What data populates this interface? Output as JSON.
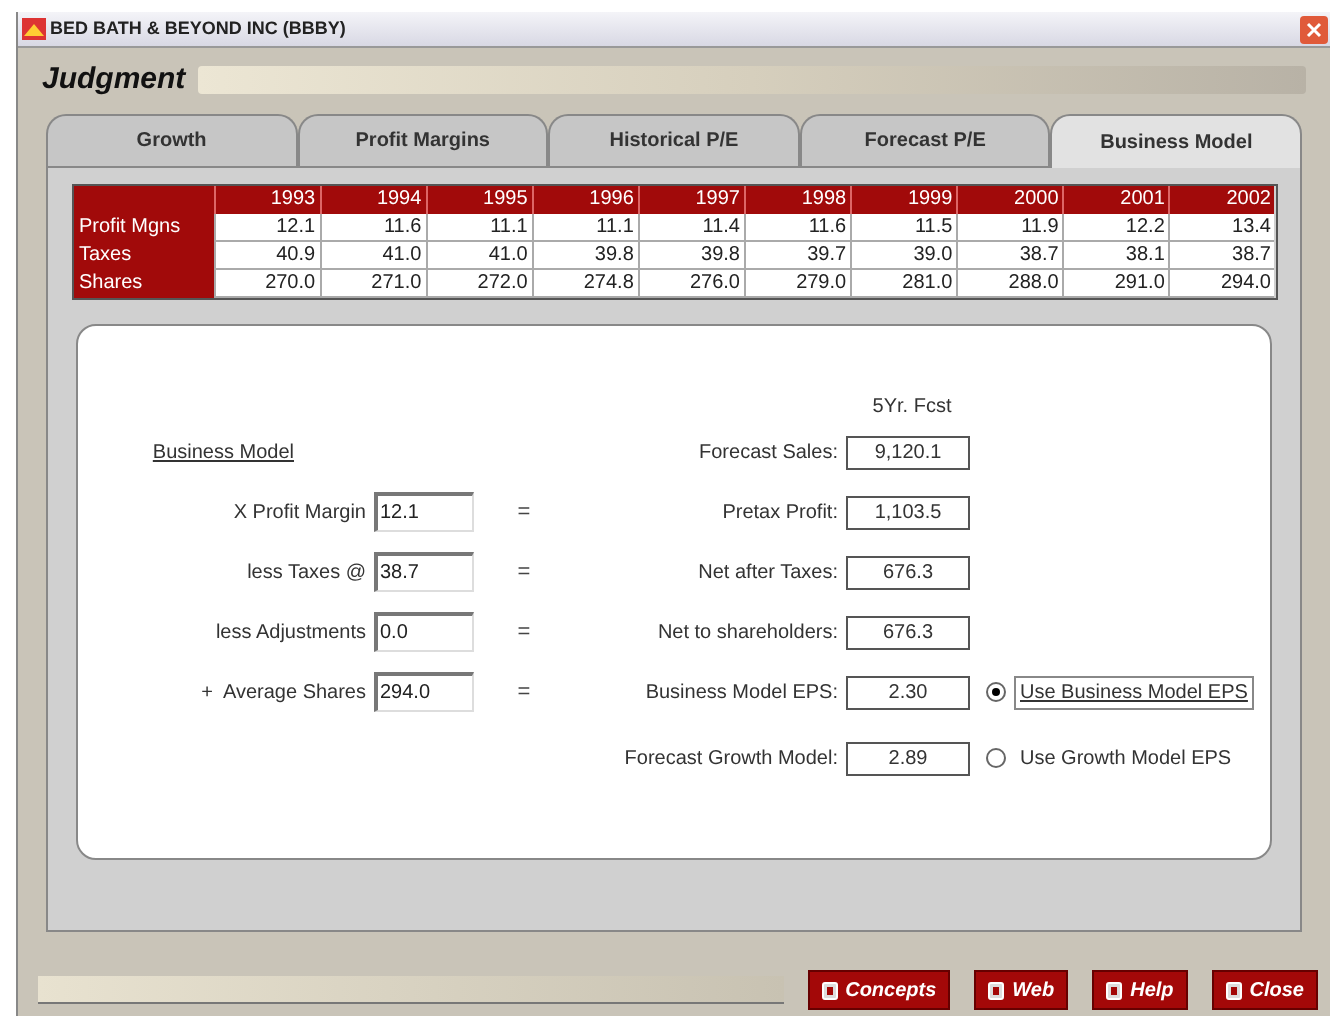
{
  "window": {
    "title": "BED BATH & BEYOND INC (BBBY)"
  },
  "header": {
    "title": "Judgment"
  },
  "tabs": [
    {
      "label": "Growth",
      "selected": false
    },
    {
      "label": "Profit Margins",
      "selected": false
    },
    {
      "label": "Historical P/E",
      "selected": false
    },
    {
      "label": "Forecast P/E",
      "selected": false
    },
    {
      "label": "Business Model",
      "selected": true
    }
  ],
  "table": {
    "columns": [
      "1993",
      "1994",
      "1995",
      "1996",
      "1997",
      "1998",
      "1999",
      "2000",
      "2001",
      "2002"
    ],
    "rows": [
      {
        "label": "Profit Mgns",
        "cells": [
          "12.1",
          "11.6",
          "11.1",
          "11.1",
          "11.4",
          "11.6",
          "11.5",
          "11.9",
          "12.2",
          "13.4"
        ]
      },
      {
        "label": "Taxes",
        "cells": [
          "40.9",
          "41.0",
          "41.0",
          "39.8",
          "39.8",
          "39.7",
          "39.0",
          "38.7",
          "38.1",
          "38.7"
        ]
      },
      {
        "label": "Shares",
        "cells": [
          "270.0",
          "271.0",
          "272.0",
          "274.8",
          "276.0",
          "279.0",
          "281.0",
          "288.0",
          "291.0",
          "294.0"
        ]
      }
    ]
  },
  "form": {
    "heading": "Business Model",
    "column_heading": "5Yr. Fcst",
    "inputs": [
      {
        "label": "X Profit Margin",
        "value": "12.1",
        "operator": "="
      },
      {
        "label": "less Taxes @",
        "value": "38.7",
        "operator": "="
      },
      {
        "label": "less Adjustments",
        "value": "0.0",
        "operator": "="
      },
      {
        "label": "+  Average Shares",
        "value": "294.0",
        "operator": "="
      }
    ],
    "outputs": [
      {
        "label": "Forecast Sales:",
        "value": "9,120.1"
      },
      {
        "label": "Pretax Profit:",
        "value": "1,103.5"
      },
      {
        "label": "Net after Taxes:",
        "value": "676.3"
      },
      {
        "label": "Net to shareholders:",
        "value": "676.3"
      },
      {
        "label": "Business Model EPS:",
        "value": "2.30",
        "option": {
          "label": "Use Business Model EPS",
          "selected": true
        }
      },
      {
        "label": "Forecast Growth Model:",
        "value": "2.89",
        "option": {
          "label": "Use Growth Model EPS",
          "selected": false
        }
      }
    ]
  },
  "buttons": [
    "Concepts",
    "Web",
    "Help",
    "Close"
  ]
}
